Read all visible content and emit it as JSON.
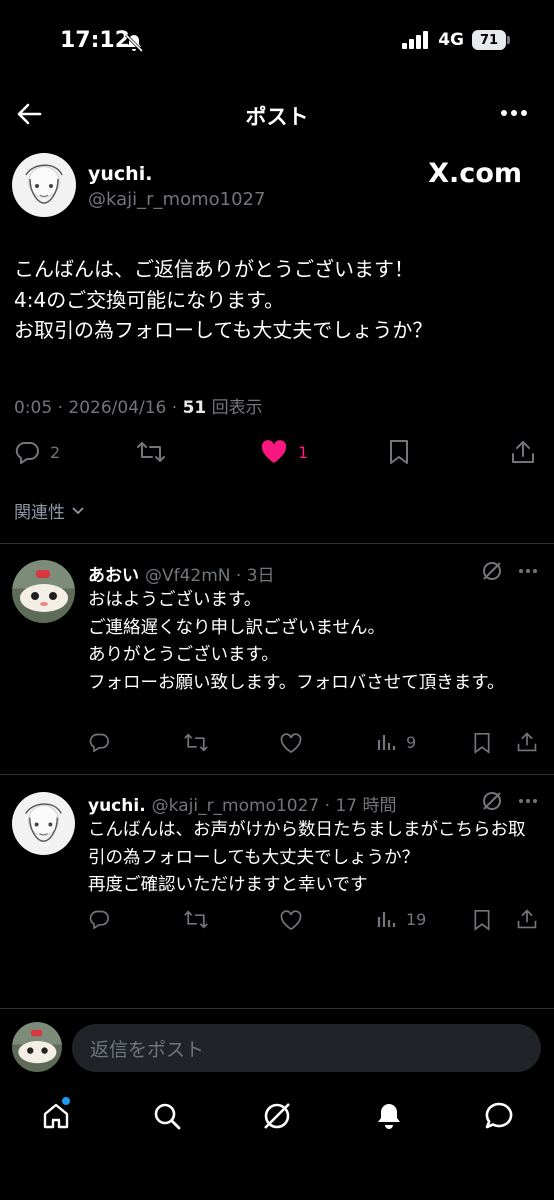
{
  "status_bar": {
    "time": "17:12",
    "network": "4G",
    "battery": "71"
  },
  "header": {
    "title": "ポスト"
  },
  "post": {
    "author_name": "yuchi.",
    "author_handle": "@kaji_r_momo1027",
    "source_label": "X.com",
    "text": "こんばんは、ご返信ありがとうございます！\n4:4のご交換可能になります。\nお取引の為フォローしても大丈夫でしょうか？",
    "timestamp": "0:05 · 2026/04/16 · ",
    "views_count": "51",
    "views_label": "回表示",
    "reply_count": "2",
    "like_count": "1"
  },
  "sort": {
    "label": "関連性"
  },
  "replies": [
    {
      "name": "あおい",
      "handle": "@Vf42mN · 3日",
      "text": "おはようございます。\nご連絡遅くなり申し訳ございません。\nありがとうございます。\nフォローお願い致します。フォロバさせて頂きます。",
      "views": "9"
    },
    {
      "name": "yuchi.",
      "handle": "@kaji_r_momo1027 · 17 時間",
      "text": "こんばんは、お声がけから数日たちましまがこちらお取引の為フォローしても大丈夫でしょうか？\n再度ご確認いただけますと幸いです",
      "views": "19"
    }
  ],
  "compose": {
    "placeholder": "返信をポスト"
  },
  "colors": {
    "like": "#f91880",
    "accent": "#1d9bf0",
    "muted": "#71767b"
  },
  "icons": [
    "back-arrow-icon",
    "more-icon",
    "reply-icon",
    "repost-icon",
    "heart-icon",
    "bookmark-icon",
    "share-icon",
    "views-icon",
    "grok-icon",
    "home-icon",
    "search-icon",
    "bell-icon",
    "messages-icon"
  ]
}
